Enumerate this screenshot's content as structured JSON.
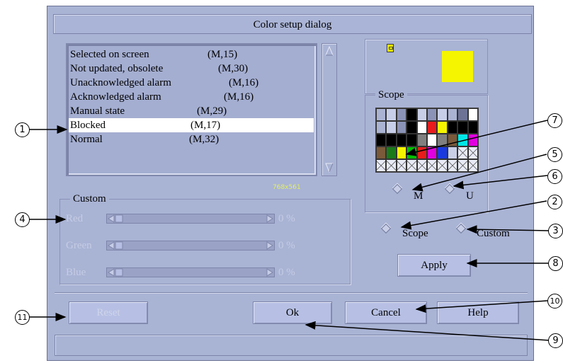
{
  "dialog": {
    "title": "Color setup dialog"
  },
  "list": {
    "items": [
      {
        "name": "Selected on screen",
        "code": "(M,15)",
        "selected": false
      },
      {
        "name": "Not updated, obsolete",
        "code": "(M,30)",
        "selected": false
      },
      {
        "name": "Unacknowledged alarm",
        "code": "(M,16)",
        "selected": false
      },
      {
        "name": "Acknowledged alarm",
        "code": "(M,16)",
        "selected": false
      },
      {
        "name": "Manual state",
        "code": "(M,29)",
        "selected": false
      },
      {
        "name": "Blocked",
        "code": "(M,17)",
        "selected": true
      },
      {
        "name": "Normal",
        "code": "(M,32)",
        "selected": false
      }
    ]
  },
  "size_label": "768x561",
  "custom": {
    "label": "Custom",
    "sliders": [
      {
        "label": "Red",
        "value": "0 %"
      },
      {
        "label": "Green",
        "value": "0 %"
      },
      {
        "label": "Blue",
        "value": "0 %"
      }
    ]
  },
  "preview": {
    "color": "#f5f500"
  },
  "scope": {
    "label": "Scope",
    "radio_m": "M",
    "radio_u": "U",
    "palette": [
      [
        "#aab3d2",
        "#c7cee8",
        "#8b93b6",
        "#000000",
        "#c9cfe6",
        "#8b93b6",
        "#c7cee8",
        "#aab3d2",
        "#6c7394",
        "#ffffff"
      ],
      [
        "#aab3d2",
        "#c7cee8",
        "#8b93b6",
        "#000000",
        "#ffffff",
        "#e81c1c",
        "#f5f500",
        "#000000",
        "#000000",
        "#000000"
      ],
      [
        "#000000",
        "#000000",
        "#000000",
        "#000000",
        "#808080",
        "#ffffff",
        "#808080",
        "#7a5a3a",
        "#00e6e6",
        "#e000e0"
      ],
      [
        "#7a5a3a",
        "#1a7a1a",
        "#f5f500",
        "#00c000",
        "#e81c1c",
        "#e000e0",
        "#1a3ae0",
        "#c9cfe6",
        "x",
        "x"
      ],
      [
        "x",
        "x",
        "x",
        "x",
        "x",
        "x",
        "x",
        "x",
        "x",
        "x"
      ]
    ]
  },
  "mode": {
    "scope_label": "Scope",
    "custom_label": "Custom"
  },
  "buttons": {
    "apply": "Apply",
    "reset": "Reset",
    "ok": "Ok",
    "cancel": "Cancel",
    "help": "Help"
  },
  "callouts": [
    "1",
    "2",
    "3",
    "4",
    "5",
    "6",
    "7",
    "8",
    "9",
    "10",
    "11"
  ]
}
